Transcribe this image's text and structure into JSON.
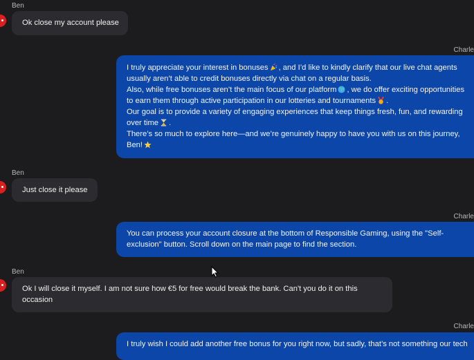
{
  "messages": [
    {
      "sender": "Ben",
      "lines": [
        "Ok close my account please"
      ]
    },
    {
      "sender": "Charle",
      "lines": [
        "I truly appreciate your interest in bonuses",
        ", and I’d like to kindly clarify that our live chat agents",
        "usually aren’t able to credit bonuses directly via chat on a regular basis.",
        "Also, while free bonuses aren’t the main focus of our platform",
        ", we do offer exciting opportunities",
        "to earn them through active participation in our lotteries and tournaments",
        ".",
        "Our goal is to provide a variety of engaging experiences that keep things fresh, fun, and rewarding",
        "over time",
        ".",
        "There’s so much to explore here—and we’re genuinely happy to have you with us on this journey,",
        "Ben!"
      ]
    },
    {
      "sender": "Ben",
      "lines": [
        "Just close it please"
      ]
    },
    {
      "sender": "Charle",
      "lines": [
        "You can process your account closure at the bottom of Responsible Gaming, using the \"Self-",
        "exclusion\" button. Scroll down on the main page to find the section."
      ]
    },
    {
      "sender": "Ben",
      "lines": [
        "Ok I will close it myself. I am not sure how €5 for free would break the bank. Can't you do it on this",
        "occasion"
      ]
    },
    {
      "sender": "Charle",
      "lines": [
        "I truly wish I could add another free bonus for you right now, but sadly, that’s not something our tech"
      ]
    }
  ],
  "icons": {
    "avatar": "user-avatar-icon",
    "party": "party-popper-icon",
    "globe": "globe-icon",
    "medal": "medal-icon",
    "hourglass": "hourglass-icon",
    "star": "star-icon",
    "cursor": "mouse-cursor-icon"
  },
  "colors": {
    "background": "#1c1c1e",
    "incoming_bubble": "#2c2c30",
    "outgoing_bubble": "#0b46a8",
    "avatar": "#d92020"
  }
}
